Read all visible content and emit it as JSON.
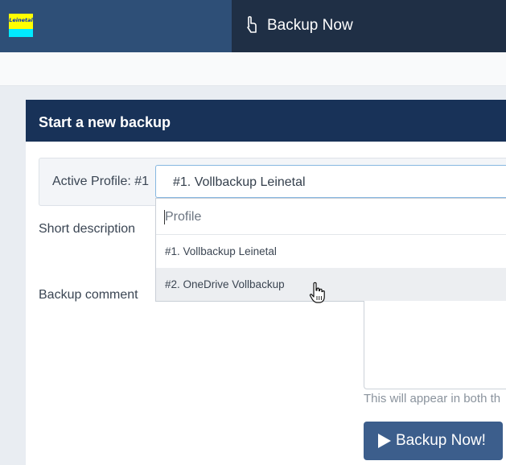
{
  "app": {
    "logo_text": "Leinetal",
    "page_title": "Backup Now"
  },
  "card": {
    "title": "Start a new backup"
  },
  "profile": {
    "label": "Active Profile: #1",
    "selected": "#1. Vollbackup Leinetal",
    "search_placeholder": "Profile",
    "options": [
      "#1. Vollbackup Leinetal",
      "#2. OneDrive Vollbackup"
    ],
    "hovered_index": 1
  },
  "form": {
    "short_description_label": "Short description",
    "backup_comment_label": "Backup comment",
    "comment_help": "This will appear in both th"
  },
  "actions": {
    "backup_now_label": "Backup Now!"
  },
  "colors": {
    "header": "#2e4f77",
    "header_dark": "#1f2f45",
    "card_header": "#183258",
    "button": "#3c5e8c"
  },
  "icons": {
    "title": "hand-pointer-icon",
    "button": "play-icon",
    "cursor": "hand-cursor-icon"
  }
}
